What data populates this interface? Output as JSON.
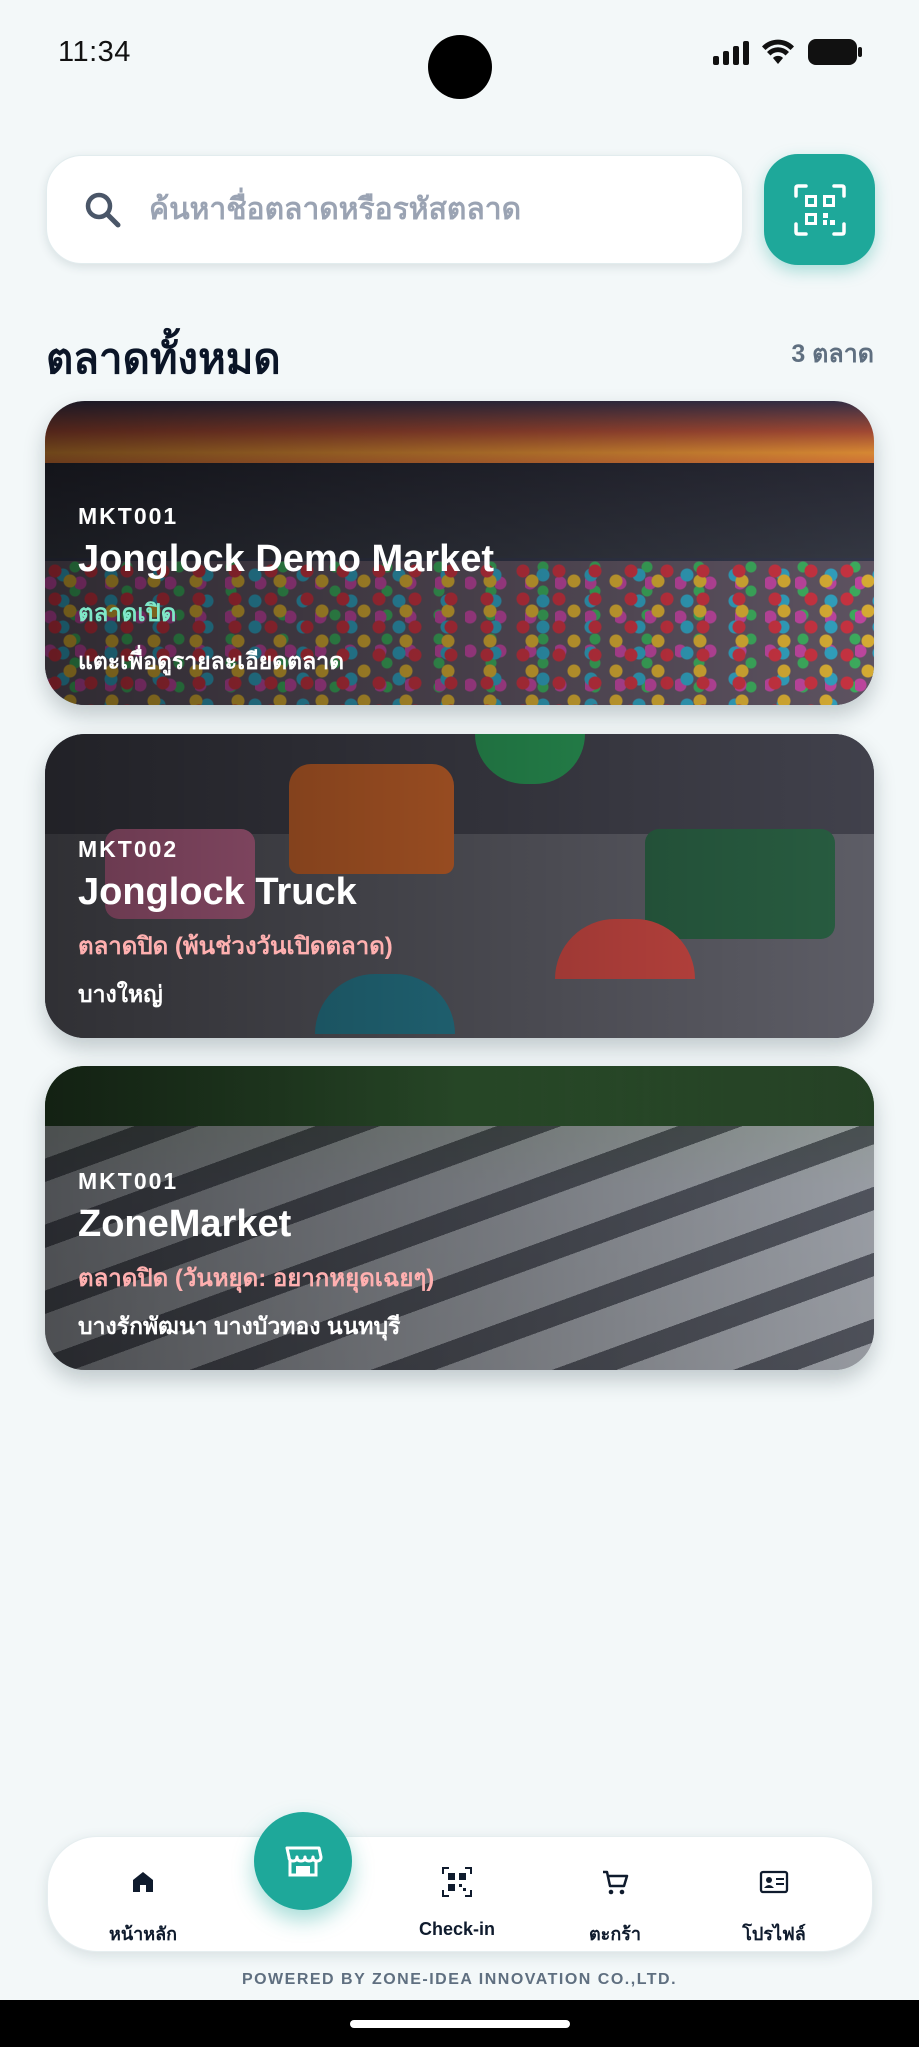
{
  "status_bar": {
    "time": "11:34"
  },
  "search": {
    "placeholder": "ค้นหาชื่อตลาดหรือรหัสตลาด",
    "qr_icon": "qr-scan-icon"
  },
  "section": {
    "title": "ตลาดทั้งหมด",
    "count": "3 ตลาด"
  },
  "markets": [
    {
      "code": "MKT001",
      "name": "Jonglock Demo Market",
      "status": "ตลาดเปิด",
      "status_color": "#7fe8c8",
      "subtitle": "แตะเพื่อดูรายละเอียดตลาด"
    },
    {
      "code": "MKT002",
      "name": "Jonglock Truck",
      "status": "ตลาดปิด (พ้นช่วงวันเปิดตลาด)",
      "status_color": "#ffb0b0",
      "subtitle": "บางใหญ่"
    },
    {
      "code": "MKT001",
      "name": "ZoneMarket",
      "status": "ตลาดปิด (วันหยุด: อยากหยุดเฉยๆ)",
      "status_color": "#ffb0b0",
      "subtitle": "บางรักพัฒนา บางบัวทอง นนทบุรี"
    }
  ],
  "bottom_nav": {
    "items": [
      {
        "label": "หน้าหลัก",
        "icon": "home-icon"
      },
      {
        "label": "",
        "icon": "store-icon"
      },
      {
        "label": "Check-in",
        "icon": "qr-icon"
      },
      {
        "label": "ตะกร้า",
        "icon": "cart-icon"
      },
      {
        "label": "โปรไฟล์",
        "icon": "profile-card-icon"
      }
    ]
  },
  "footer": {
    "powered_by": "POWERED BY ZONE-IDEA INNOVATION CO.,LTD."
  },
  "colors": {
    "accent": "#1ea89a",
    "background": "#f3f8f9",
    "open_status": "#7fe8c8",
    "closed_status": "#ffb0b0"
  }
}
